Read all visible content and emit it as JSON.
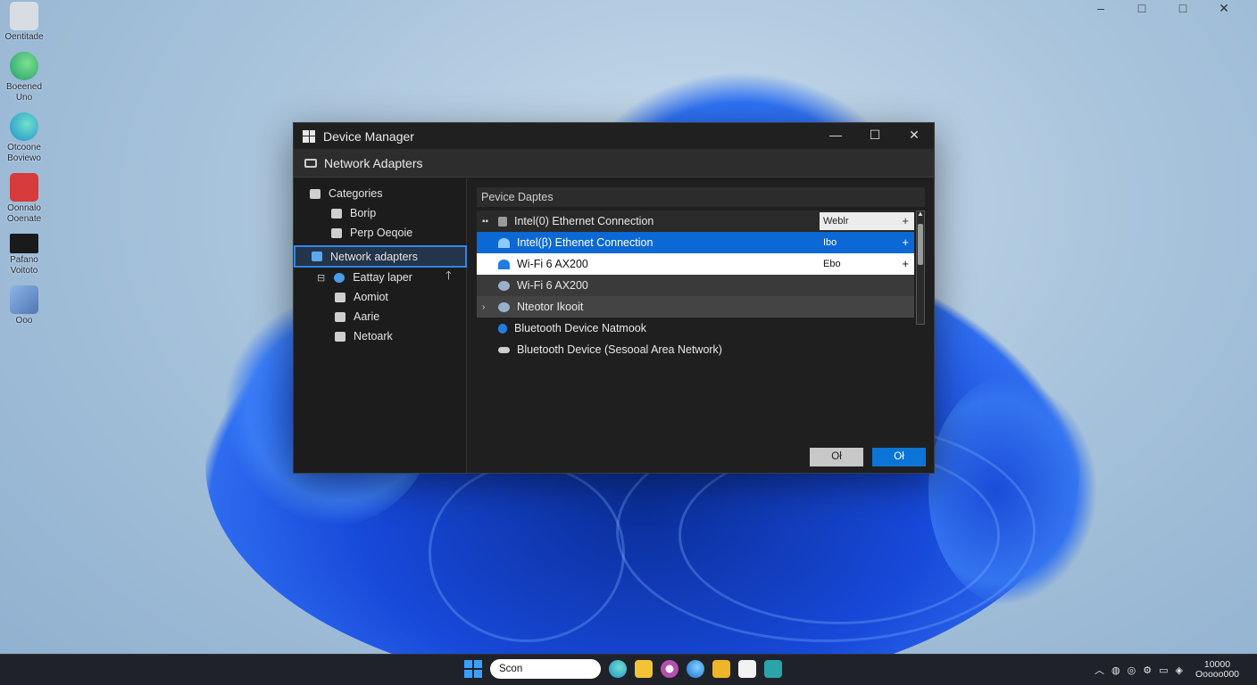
{
  "desktop": {
    "window_controls": [
      "–",
      "□",
      "□",
      "✕"
    ],
    "icons": [
      {
        "label": "Oentitade",
        "icon": "recycle-bin-icon",
        "color": "#d8dde4"
      },
      {
        "label": "Boeened Uno",
        "icon": "edge-icon",
        "color": "#2fb07a"
      },
      {
        "label": "Otcoone Boviewo",
        "icon": "edge-icon",
        "color": "#29a3d8"
      },
      {
        "label": "Oonnalo Ooenate",
        "icon": "app-red-icon",
        "color": "#d63a3a"
      },
      {
        "label": "Pafano Voitoto",
        "icon": "terminal-icon",
        "color": "#1a1a1a"
      },
      {
        "label": "Ooo",
        "icon": "app-files-icon",
        "color": "#6a8fbf"
      }
    ]
  },
  "window": {
    "title": "Device Manager",
    "controls": [
      "—",
      "☐",
      "✕"
    ],
    "subheader": "Network Adapters",
    "sidebar": {
      "categories_label": "Categories",
      "items": [
        "Borip",
        "Perp Oeqoie"
      ],
      "selected": "Network adapters",
      "children": [
        "Eattay laper",
        "Aomiot",
        "Aarie",
        "Netoark"
      ]
    },
    "list": {
      "column_header": "Pevice Daptes",
      "rows": [
        {
          "name": "Intel(0) Ethernet Connection",
          "value": "Weblr",
          "style": "r0"
        },
        {
          "name": "Intel(β) Ethenet Connection",
          "value": "Ibo",
          "style": "r1"
        },
        {
          "name": "Wi-Fi 6 AX200",
          "value": "Ebo",
          "style": "r2"
        },
        {
          "name": "Wi-Fi 6 AX200",
          "value": "",
          "style": "r3"
        },
        {
          "name": "Nteotor Ikooit",
          "value": "",
          "style": "r4"
        },
        {
          "name": "Bluetooth Device Natmook",
          "value": "",
          "style": ""
        },
        {
          "name": "Bluetooth Device (Sesooal Area Network)",
          "value": "",
          "style": ""
        }
      ]
    },
    "buttons": {
      "secondary": "Oł",
      "primary": "Oł"
    }
  },
  "taskbar": {
    "search_placeholder": "Scon",
    "clock_time": "10000",
    "clock_date": "Ooooo000"
  }
}
